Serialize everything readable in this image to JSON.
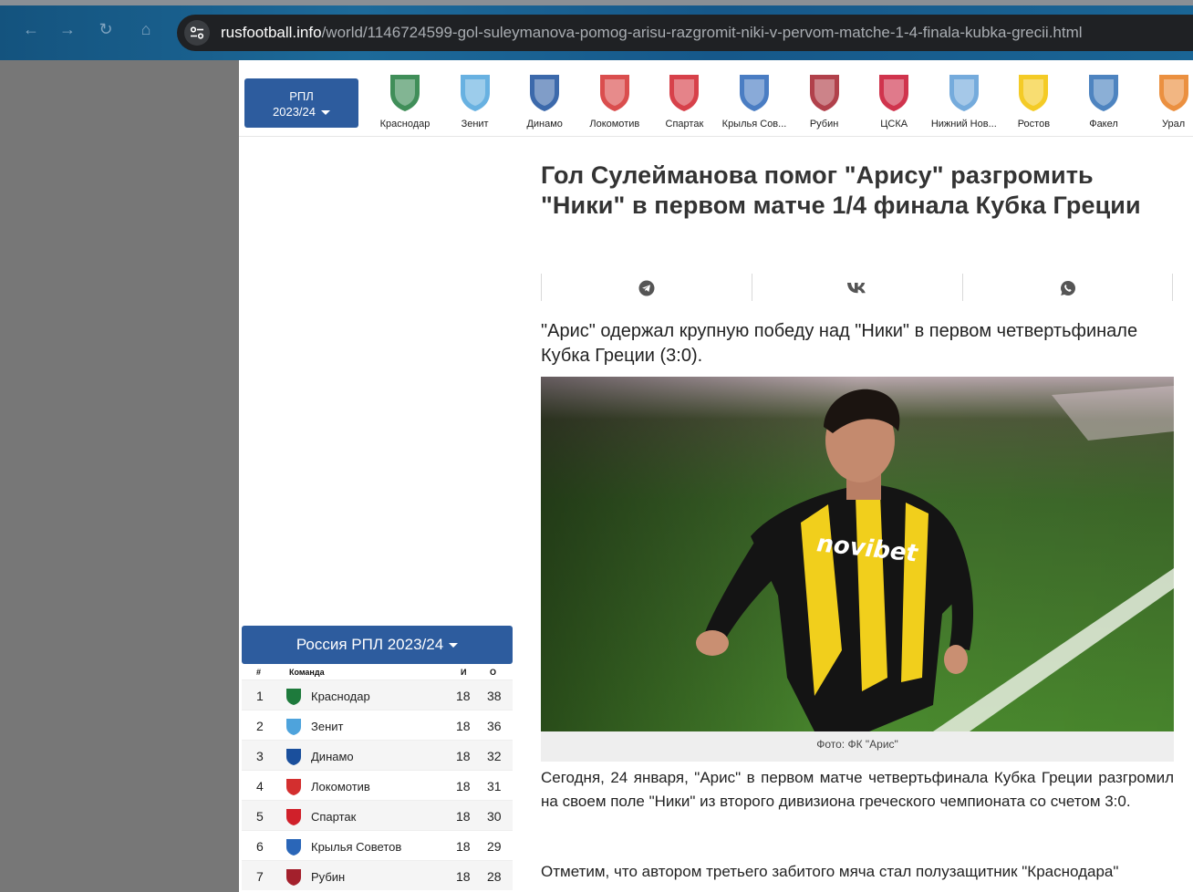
{
  "browser": {
    "url_host": "rusfootball.info",
    "url_path": "/world/1146724599-gol-suleymanova-pomog-arisu-razgromit-niki-v-pervom-matche-1-4-finala-kubka-grecii.html"
  },
  "clubstrip": {
    "season_line1": "РПЛ",
    "season_line2": "2023/24",
    "clubs": [
      {
        "name": "Краснодар",
        "color": "#1e7a3c"
      },
      {
        "name": "Зенит",
        "color": "#4ea3dc"
      },
      {
        "name": "Динамо",
        "color": "#1a4f9c"
      },
      {
        "name": "Локомотив",
        "color": "#d32f2f"
      },
      {
        "name": "Спартак",
        "color": "#d0202a"
      },
      {
        "name": "Крылья Сов...",
        "color": "#2a66b8"
      },
      {
        "name": "Рубин",
        "color": "#a3202c"
      },
      {
        "name": "ЦСКА",
        "color": "#c8102e"
      },
      {
        "name": "Нижний Нов...",
        "color": "#5d9cd6"
      },
      {
        "name": "Ростов",
        "color": "#f2c200"
      },
      {
        "name": "Факел",
        "color": "#2f6fb5"
      },
      {
        "name": "Урал",
        "color": "#e87d1e"
      }
    ]
  },
  "standings": {
    "title": "Россия РПЛ 2023/24",
    "col_pos": "#",
    "col_team": "Команда",
    "col_games": "И",
    "col_points": "О",
    "rows": [
      {
        "pos": "1",
        "team": "Краснодар",
        "games": "18",
        "points": "38",
        "color": "#1e7a3c"
      },
      {
        "pos": "2",
        "team": "Зенит",
        "games": "18",
        "points": "36",
        "color": "#4ea3dc"
      },
      {
        "pos": "3",
        "team": "Динамо",
        "games": "18",
        "points": "32",
        "color": "#1a4f9c"
      },
      {
        "pos": "4",
        "team": "Локомотив",
        "games": "18",
        "points": "31",
        "color": "#d32f2f"
      },
      {
        "pos": "5",
        "team": "Спартак",
        "games": "18",
        "points": "30",
        "color": "#d0202a"
      },
      {
        "pos": "6",
        "team": "Крылья Советов",
        "games": "18",
        "points": "29",
        "color": "#2a66b8"
      },
      {
        "pos": "7",
        "team": "Рубин",
        "games": "18",
        "points": "28",
        "color": "#a3202c"
      }
    ]
  },
  "article": {
    "title": "Гол Сулейманова помог \"Арису\" разгромить \"Ники\" в первом матче 1/4 финала Кубка Греции",
    "lead": "\"Арис\" одержал крупную победу над \"Ники\" в первом четвертьфинале Кубка Греции (3:0).",
    "photo_caption": "Фото: ФК \"Арис\"",
    "jersey_text": "novibet",
    "para1": "Сегодня, 24 января, \"Арис\" в первом матче четвертьфинала Кубка Греции разгромил на своем поле \"Ники\" из второго дивизиона греческого чемпионата со счетом 3:0.",
    "para2": "Отметим, что автором третьего забитого мяча стал полузащитник \"Краснодара\""
  },
  "share_icons": [
    "telegram-icon",
    "vk-icon",
    "whatsapp-icon"
  ]
}
